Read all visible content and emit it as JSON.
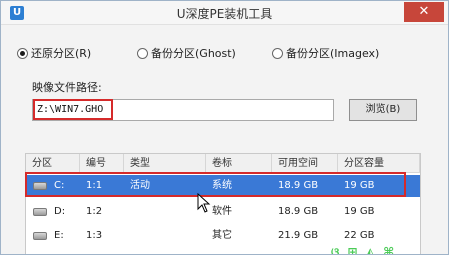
{
  "window": {
    "title": "U深度PE装机工具",
    "close_glyph": "✕"
  },
  "modes": [
    {
      "label": "还原分区(R)",
      "checked": true
    },
    {
      "label": "备份分区(Ghost)",
      "checked": false
    },
    {
      "label": "备份分区(Imagex)",
      "checked": false
    }
  ],
  "image_path": {
    "label": "映像文件路径:",
    "value": "Z:\\WIN7.GHO",
    "browse_label": "浏览(B)"
  },
  "partition_table": {
    "columns": [
      "分区",
      "编号",
      "类型",
      "卷标",
      "可用空间",
      "分区容量"
    ],
    "rows": [
      {
        "drive": "C:",
        "number": "1:1",
        "type": "活动",
        "label": "系统",
        "free": "18.9 GB",
        "size": "19 GB",
        "selected": true
      },
      {
        "drive": "D:",
        "number": "1:2",
        "type": "",
        "label": "软件",
        "free": "18.9 GB",
        "size": "19 GB",
        "selected": false
      },
      {
        "drive": "E:",
        "number": "1:3",
        "type": "",
        "label": "其它",
        "free": "21.9 GB",
        "size": "22 GB",
        "selected": false
      }
    ]
  },
  "colors": {
    "selection": "#3a79d6",
    "highlight_border": "#d52a2a",
    "close_button": "#c7463a"
  }
}
